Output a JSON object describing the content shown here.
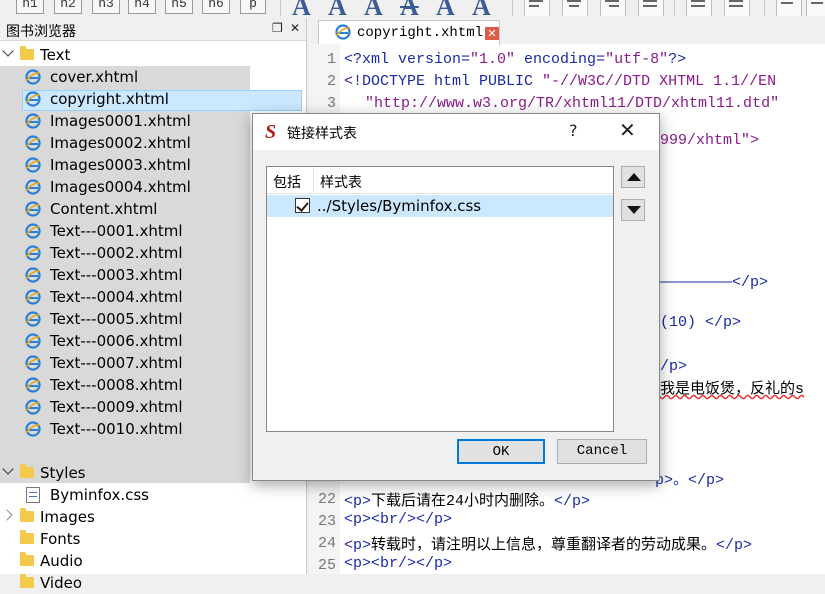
{
  "toolbar": {
    "heading_buttons": [
      "h1",
      "h2",
      "h3",
      "h4",
      "h5",
      "h6",
      "p"
    ],
    "font_style_glyphs": [
      "A",
      "A",
      "A",
      "A",
      "A",
      "A"
    ]
  },
  "browser": {
    "title": "图书浏览器",
    "folders": {
      "text": "Text",
      "styles": "Styles",
      "images": "Images",
      "fonts": "Fonts",
      "audio": "Audio",
      "video": "Video"
    },
    "text_files": [
      "cover.xhtml",
      "copyright.xhtml",
      "Images0001.xhtml",
      "Images0002.xhtml",
      "Images0003.xhtml",
      "Images0004.xhtml",
      "Content.xhtml",
      "Text---0001.xhtml",
      "Text---0002.xhtml",
      "Text---0003.xhtml",
      "Text---0004.xhtml",
      "Text---0005.xhtml",
      "Text---0006.xhtml",
      "Text---0007.xhtml",
      "Text---0008.xhtml",
      "Text---0009.xhtml",
      "Text---0010.xhtml"
    ],
    "style_files": [
      "Byminfox.css"
    ]
  },
  "editor": {
    "tab_label": "copyright.xhtml",
    "close_glyph": "✕",
    "line_numbers": {
      "l1": "1",
      "l2": "2",
      "l3": "3",
      "l22": "22",
      "l23": "23",
      "l24": "24",
      "l25": "25"
    },
    "code": {
      "l1_a": "<?xml version=",
      "l1_b": "\"1.0\"",
      "l1_c": " encoding=",
      "l1_d": "\"utf-8\"",
      "l1_e": "?>",
      "l2_a": "<!DOCTYPE html PUBLIC ",
      "l2_b": "\"-//W3C//DTD XHTML 1.1//EN",
      "l3_a": "\"http://www.w3.org/TR/xhtml11/DTD/xhtml11.dtd\"",
      "l4_a": "999/xhtml\">",
      "l_dash": "————————</p>",
      "l_ten": "(10) </p>",
      "l_p": "/p>",
      "l_rice": "我是电饭煲，反礼的s",
      "l_obscured": "p>。</p>",
      "l22_a": "<p>",
      "l22_b": "下载后请在24小时内删除。",
      "l22_c": "</p>",
      "l23_a": "<p><br/></p>",
      "l24_a": "<p>",
      "l24_b": "转载时，请注明以上信息，尊重翻译者的劳动成果。",
      "l24_c": "</p>",
      "l25_a": "<p><br/></p>"
    }
  },
  "dialog": {
    "logo": "S",
    "title": "链接样式表",
    "help": "?",
    "close": "✕",
    "columns": [
      "包括",
      "样式表"
    ],
    "rows": [
      {
        "included": true,
        "stylesheet": "../Styles/Byminfox.css"
      }
    ],
    "ok_label": "OK",
    "cancel_label": "Cancel"
  }
}
